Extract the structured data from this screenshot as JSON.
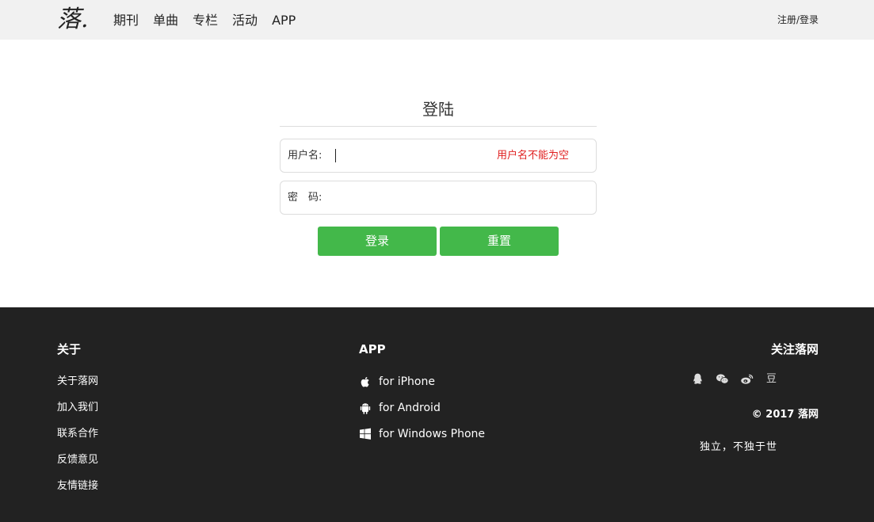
{
  "header": {
    "logo": "落.",
    "nav": [
      "期刊",
      "单曲",
      "专栏",
      "活动",
      "APP"
    ],
    "register_login": "注册/登录"
  },
  "login": {
    "title": "登陆",
    "username_label": "用户名:",
    "username_value": "",
    "username_error": "用户名不能为空",
    "password_label": "密　码:",
    "password_value": "",
    "login_button": "登录",
    "reset_button": "重置"
  },
  "footer": {
    "about_title": "关于",
    "about_links": [
      "关于落网",
      "加入我们",
      "联系合作",
      "反馈意见",
      "友情链接"
    ],
    "app_title": "APP",
    "app_links": [
      {
        "icon": "apple-icon",
        "label": "for iPhone"
      },
      {
        "icon": "android-icon",
        "label": "for Android"
      },
      {
        "icon": "windows-icon",
        "label": "for Windows Phone"
      }
    ],
    "follow_title": "关注落网",
    "social_icons": [
      "qq-icon",
      "wechat-icon",
      "weibo-icon",
      "douban-icon"
    ],
    "douban_glyph": "豆",
    "copyright": "© 2017 落网",
    "slogan": "独立，不独于世"
  },
  "colors": {
    "header_bg": "#f1f1f1",
    "accent_green": "#43b84a",
    "error_red": "#e02020",
    "footer_bg": "#222222"
  }
}
